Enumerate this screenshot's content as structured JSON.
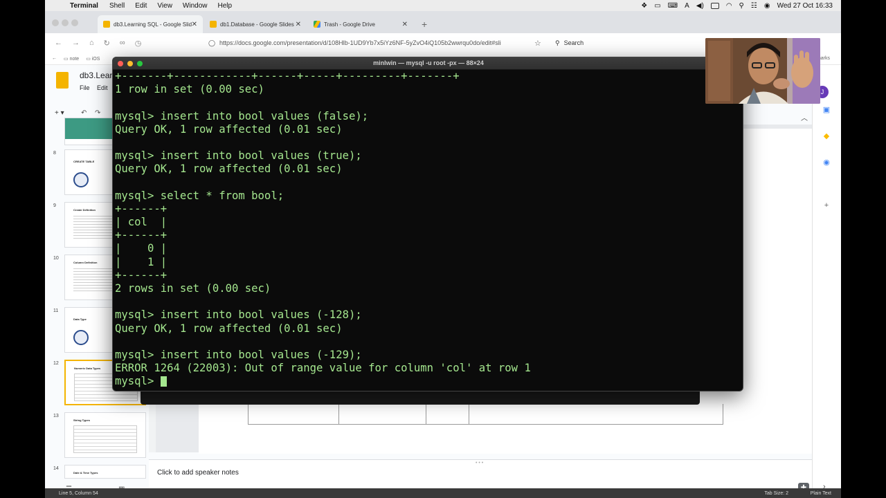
{
  "menubar": {
    "app": "Terminal",
    "items": [
      "Shell",
      "Edit",
      "View",
      "Window",
      "Help"
    ],
    "clock": "Wed 27 Oct  16:33"
  },
  "browser": {
    "tabs": [
      {
        "label": "db3.Learning SQL - Google Slid",
        "active": true,
        "icon": "google-slides-icon",
        "color": "#f4b400"
      },
      {
        "label": "db1.Database - Google Slides",
        "active": false,
        "icon": "google-slides-icon",
        "color": "#f4b400"
      },
      {
        "label": "Trash - Google Drive",
        "active": false,
        "icon": "google-drive-icon",
        "color": "#34a853"
      }
    ],
    "url": "https://docs.google.com/presentation/d/108Hlb-1UD9Yb7x5iYz6NF-5yZvO4iQ105b2wwrqu0do/edit#sli",
    "search_label": "Search",
    "bookmarks": [
      "note",
      "iOS"
    ],
    "bookmarks_right": "marks"
  },
  "slides": {
    "doc_title": "db3.Lear",
    "menu": [
      "File",
      "Edit"
    ],
    "thumbnails": [
      {
        "num": "8",
        "title": "CREATE TABLE",
        "kind": "seal"
      },
      {
        "num": "9",
        "title": "Create Definition",
        "kind": "lines"
      },
      {
        "num": "10",
        "title": "Column Definition",
        "kind": "lines"
      },
      {
        "num": "11",
        "title": "Data Type",
        "kind": "seal"
      },
      {
        "num": "12",
        "title": "Numeric Data Types",
        "kind": "table",
        "selected": true
      },
      {
        "num": "13",
        "title": "String Types",
        "kind": "table"
      },
      {
        "num": "14",
        "title": "Date & Time Types",
        "kind": "lines"
      }
    ],
    "speaker_notes": "Click to add speaker notes",
    "avatar_letter": "J"
  },
  "statusbar": {
    "position": "Line 5, Column 54",
    "tab_size": "Tab Size: 2",
    "mode": "Plain Text"
  },
  "terminal": {
    "title": "minlwin — mysql -u root -px — 88×24",
    "lines": [
      "+-------+------------+------+-----+---------+-------+",
      "1 row in set (0.00 sec)",
      "",
      "mysql> insert into bool values (false);",
      "Query OK, 1 row affected (0.01 sec)",
      "",
      "mysql> insert into bool values (true);",
      "Query OK, 1 row affected (0.01 sec)",
      "",
      "mysql> select * from bool;",
      "+------+",
      "| col  |",
      "+------+",
      "|    0 |",
      "|    1 |",
      "+------+",
      "2 rows in set (0.00 sec)",
      "",
      "mysql> insert into bool values (-128);",
      "Query OK, 1 row affected (0.01 sec)",
      "",
      "mysql> insert into bool values (-129);",
      "ERROR 1264 (22003): Out of range value for column 'col' at row 1",
      "mysql> "
    ],
    "text_color": "#a4e68e"
  }
}
